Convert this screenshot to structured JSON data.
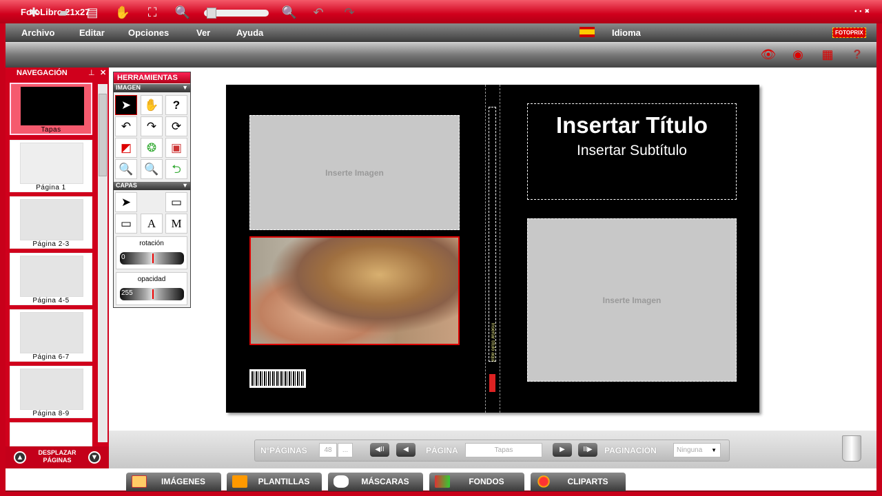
{
  "window": {
    "title": "FotoLibro 21x27",
    "controls": "▪▪✖"
  },
  "menu": {
    "items": [
      "Archivo",
      "Editar",
      "Opciones",
      "Ver",
      "Ayuda"
    ],
    "language": "Idioma",
    "brand": "FOTOPRIX"
  },
  "navigation": {
    "title": "NAVEGACIÓN",
    "pages": [
      "Tapas",
      "Página 1",
      "Página 2-3",
      "Página 4-5",
      "Página 6-7",
      "Página 8-9"
    ],
    "scroll_label": "DESPLAZAR PÁGINAS"
  },
  "tools": {
    "title": "HERRAMIENTAS",
    "image_section": "IMAGEN",
    "layers_section": "CAPAS",
    "rotation_label": "rotación",
    "rotation_value": "0",
    "opacity_label": "opacidad",
    "opacity_value": "255"
  },
  "canvas": {
    "placeholder_left": "Inserte Imagen",
    "placeholder_right": "Inserte Imagen",
    "title": "Insertar Título",
    "subtitle": "Insertar Subtítulo",
    "spine_text": "Insertar título aquí"
  },
  "pagination": {
    "num_pages_label": "NºPÁGINAS",
    "num_pages": "48",
    "more": "...",
    "page_label": "PÁGINA",
    "page_value": "Tapas",
    "pagination_label": "PAGINACIÓN",
    "pagination_value": "Ninguna"
  },
  "tabs": [
    "IMÁGENES",
    "PLANTILLAS",
    "MÁSCARAS",
    "FONDOS",
    "CLIPARTS"
  ],
  "zoom_level": 0.05
}
